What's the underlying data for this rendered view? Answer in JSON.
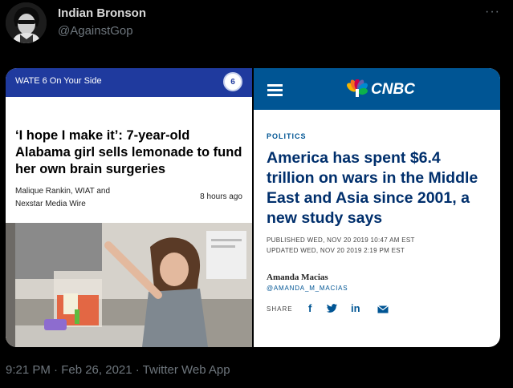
{
  "tweet": {
    "author_name": "Indian Bronson",
    "author_handle": "@AgainstGop",
    "more_icon": "more-icon",
    "timestamp": "9:21 PM · Feb 26, 2021 · Twitter Web App"
  },
  "left_image": {
    "outlet": "WATE 6 On Your Side",
    "logo_text": "6",
    "headline": "‘I hope I make it’: 7-year-old Alabama girl sells lemonade to fund her own brain surgeries",
    "byline": "Malique Rankin, WIAT and Nexstar Media Wire",
    "time": "8 hours ago"
  },
  "right_image": {
    "outlet": "CNBC",
    "section": "POLITICS",
    "headline_lines": [
      "America has spent $6.4",
      "trillion on wars in the Middle",
      "East and Asia since 2001, a",
      "new study says"
    ],
    "published": "PUBLISHED WED, NOV 20 2019 10:47 AM EST",
    "updated": "UPDATED WED, NOV 20 2019 2:19 PM EST",
    "author": "Amanda Macias",
    "author_handle": "@AMANDA_M_MACIAS",
    "share_label": "SHARE",
    "share_icons": [
      "facebook-icon",
      "twitter-icon",
      "linkedin-icon",
      "email-icon"
    ]
  },
  "colors": {
    "background": "#000000",
    "wate_blue": "#1f3a9e",
    "cnbc_blue": "#005594",
    "headline_navy": "#002f6c",
    "muted_text": "#6e767d"
  }
}
